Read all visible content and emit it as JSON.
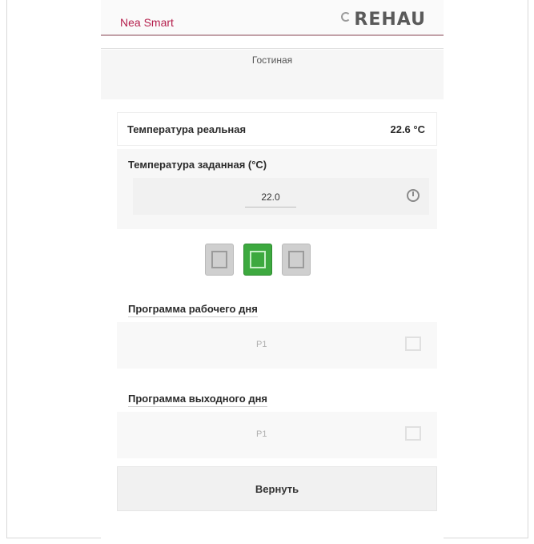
{
  "header": {
    "app_title": "Nea Smart",
    "logo_text": "REHAU",
    "accent_color": "#b5204d"
  },
  "room": {
    "name": "Гостиная"
  },
  "temperature": {
    "actual_label": "Температура реальная",
    "actual_value": "22.6 °C",
    "set_label": "Температура заданная (°C)",
    "set_value": "22.0"
  },
  "modes": {
    "items": [
      {
        "name": "mode-manual",
        "icon": "manual-mode-icon",
        "active": false
      },
      {
        "name": "mode-program",
        "icon": "program-mode-icon",
        "active": true
      },
      {
        "name": "mode-holiday",
        "icon": "holiday-mode-icon",
        "active": false
      }
    ],
    "active_color": "#3da93f"
  },
  "programs": {
    "workday_label": "Программа рабочего дня",
    "workday_value": "P1",
    "weekend_label": "Программа выходного дня",
    "weekend_value": "P1"
  },
  "reset_label": "Вернуть"
}
